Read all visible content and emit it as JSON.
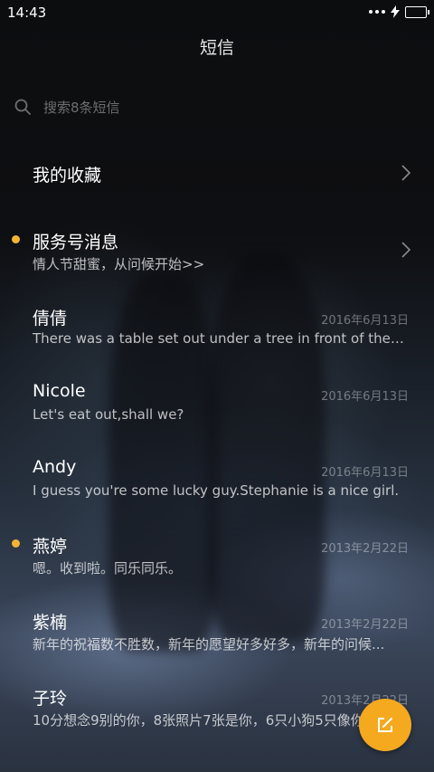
{
  "status_bar": {
    "time": "14:43"
  },
  "header": {
    "title": "短信"
  },
  "search": {
    "placeholder": "搜索8条短信"
  },
  "favorites": {
    "label": "我的收藏"
  },
  "conversations": [
    {
      "name": "服务号消息",
      "preview": "情人节甜蜜，从问候开始>>",
      "date": "",
      "unread": true,
      "has_chevron": true
    },
    {
      "name": "倩倩",
      "preview": "There was a table set out under a tree in front of the ho...",
      "date": "2016年6月13日",
      "unread": false
    },
    {
      "name": "Nicole",
      "preview": "Let's eat out,shall we?",
      "date": "2016年6月13日",
      "unread": false
    },
    {
      "name": "Andy",
      "preview": "I guess you're some lucky guy.Stephanie is a nice girl.",
      "date": "2016年6月13日",
      "unread": false
    },
    {
      "name": "燕婷",
      "preview": "嗯。收到啦。同乐同乐。",
      "date": "2013年2月22日",
      "unread": true
    },
    {
      "name": "紫楠",
      "preview": "新年的祝福数不胜数，新年的愿望好多好多，新年的问候...",
      "date": "2013年2月22日",
      "unread": false
    },
    {
      "name": "子玲",
      "preview": "10分想念9别的你，8张照片7张是你，6只小狗5只像你...",
      "date": "2013年2月22日",
      "unread": false
    }
  ],
  "colors": {
    "accent": "#f4a91e",
    "unread_dot": "#f5b433"
  },
  "icons": {
    "search": "search-icon",
    "chevron": "chevron-right-icon",
    "compose": "compose-icon"
  }
}
